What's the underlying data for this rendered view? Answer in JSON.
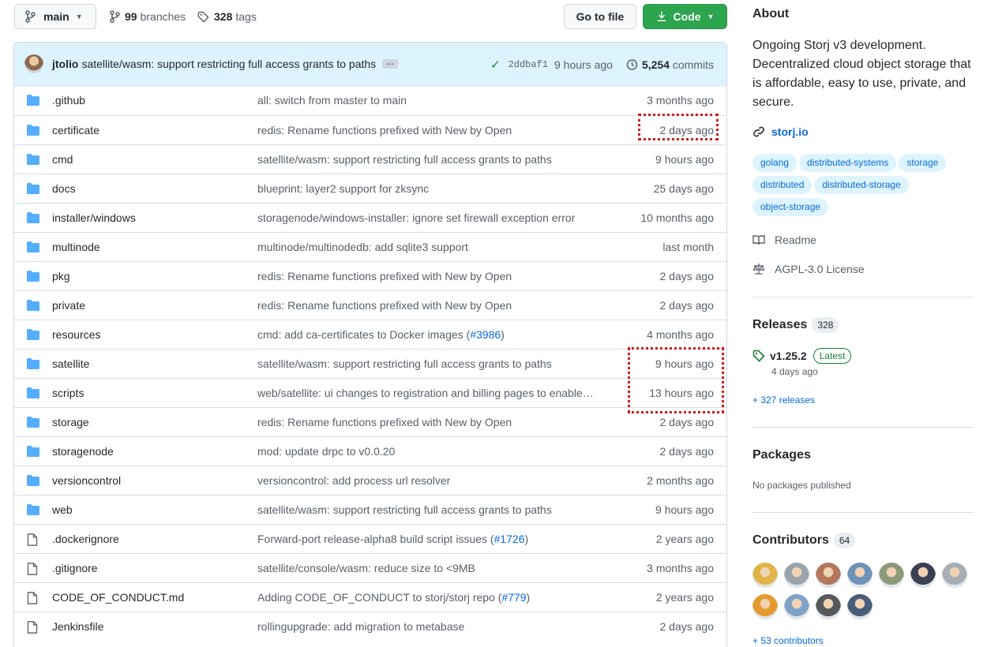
{
  "topbar": {
    "branch": "main",
    "branches_count": "99",
    "branches_label": "branches",
    "tags_count": "328",
    "tags_label": "tags",
    "goto_file": "Go to file",
    "code": "Code"
  },
  "commit": {
    "author": "jtolio",
    "message": "satellite/wasm: support restricting full access grants to paths",
    "ellipsis": "…",
    "sha": "2ddbaf1",
    "time": "9 hours ago",
    "commits_count": "5,254",
    "commits_label": "commits"
  },
  "files": [
    {
      "type": "dir",
      "name": ".github",
      "msg": "all: switch from master to main",
      "age": "3 months ago"
    },
    {
      "type": "dir",
      "name": "certificate",
      "msg": "redis: Rename functions prefixed with New by Open",
      "age": "2 days ago"
    },
    {
      "type": "dir",
      "name": "cmd",
      "msg": "satellite/wasm: support restricting full access grants to paths",
      "age": "9 hours ago"
    },
    {
      "type": "dir",
      "name": "docs",
      "msg": "blueprint: layer2 support for zksync",
      "age": "25 days ago"
    },
    {
      "type": "dir",
      "name": "installer/windows",
      "msg": "storagenode/windows-installer: ignore set firewall exception error",
      "age": "10 months ago"
    },
    {
      "type": "dir",
      "name": "multinode",
      "msg": "multinode/multinodedb: add sqlite3 support",
      "age": "last month"
    },
    {
      "type": "dir",
      "name": "pkg",
      "msg": "redis: Rename functions prefixed with New by Open",
      "age": "2 days ago"
    },
    {
      "type": "dir",
      "name": "private",
      "msg": "redis: Rename functions prefixed with New by Open",
      "age": "2 days ago"
    },
    {
      "type": "dir",
      "name": "resources",
      "msg": "cmd: add ca-certificates to Docker images (",
      "link": "#3986",
      "msg_end": ")",
      "age": "4 months ago"
    },
    {
      "type": "dir",
      "name": "satellite",
      "msg": "satellite/wasm: support restricting full access grants to paths",
      "age": "9 hours ago"
    },
    {
      "type": "dir",
      "name": "scripts",
      "msg": "web/satellite: ui changes to registration and billing pages to enable…",
      "age": "13 hours ago"
    },
    {
      "type": "dir",
      "name": "storage",
      "msg": "redis: Rename functions prefixed with New by Open",
      "age": "2 days ago"
    },
    {
      "type": "dir",
      "name": "storagenode",
      "msg": "mod: update drpc to v0.0.20",
      "age": "2 days ago"
    },
    {
      "type": "dir",
      "name": "versioncontrol",
      "msg": "versioncontrol: add process url resolver",
      "age": "2 months ago"
    },
    {
      "type": "dir",
      "name": "web",
      "msg": "satellite/wasm: support restricting full access grants to paths",
      "age": "9 hours ago"
    },
    {
      "type": "file",
      "name": ".dockerignore",
      "msg": "Forward-port release-alpha8 build script issues (",
      "link": "#1726",
      "msg_end": ")",
      "age": "2 years ago"
    },
    {
      "type": "file",
      "name": ".gitignore",
      "msg": "satellite/console/wasm: reduce size to <9MB",
      "age": "3 months ago"
    },
    {
      "type": "file",
      "name": "CODE_OF_CONDUCT.md",
      "msg": "Adding CODE_OF_CONDUCT to storj/storj repo (",
      "link": "#779",
      "msg_end": ")",
      "age": "2 years ago"
    },
    {
      "type": "file",
      "name": "Jenkinsfile",
      "msg": "rollingupgrade: add migration to metabase",
      "age": "2 days ago"
    }
  ],
  "about": {
    "title": "About",
    "description": "Ongoing Storj v3 development. Decentralized cloud object storage that is affordable, easy to use, private, and secure.",
    "website": "storj.io",
    "topics": [
      "golang",
      "distributed-systems",
      "storage",
      "distributed",
      "distributed-storage",
      "object-storage"
    ],
    "readme": "Readme",
    "license": "AGPL-3.0 License"
  },
  "releases": {
    "title": "Releases",
    "count": "328",
    "version": "v1.25.2",
    "badge": "Latest",
    "date": "4 days ago",
    "more": "+ 327 releases"
  },
  "packages": {
    "title": "Packages",
    "empty": "No packages published"
  },
  "contributors": {
    "title": "Contributors",
    "count": "64",
    "more": "+ 53 contributors",
    "avatar_colors": [
      "#e0b44a",
      "#9aa4ad",
      "#b5775d",
      "#6d93b8",
      "#8c9a7a",
      "#3c3f52",
      "#a7aeb5",
      "#e59a2e",
      "#7fa3c7",
      "#55595c",
      "#4a5e7a"
    ]
  },
  "colors": {
    "accent": "#0969da",
    "green": "#2da44e",
    "folder": "#54aeff",
    "highlight": "#d11a1a"
  }
}
